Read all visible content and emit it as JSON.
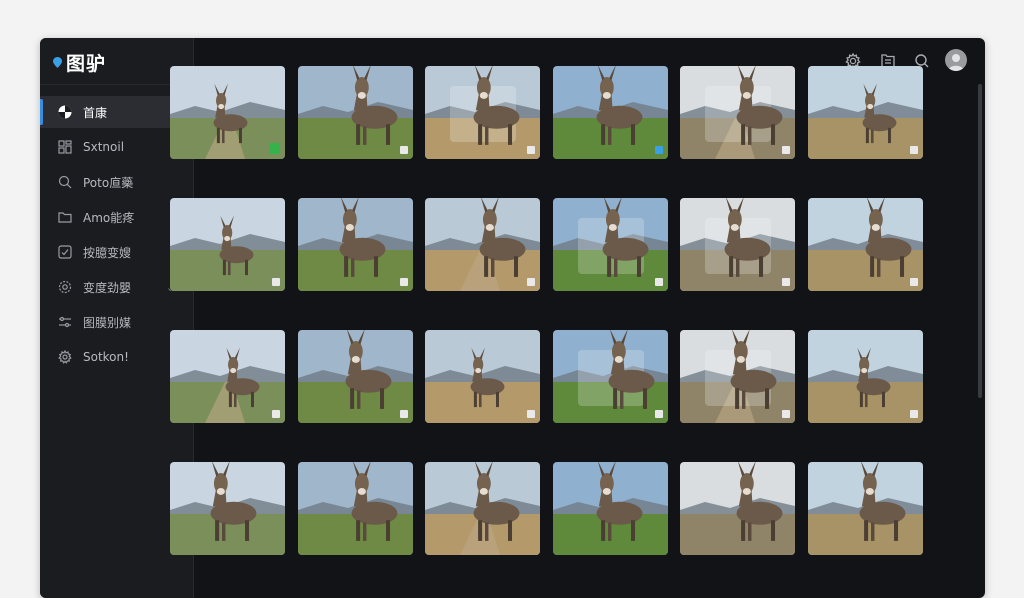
{
  "app": {
    "title": "图驴"
  },
  "sidebar": {
    "items": [
      {
        "label": "首康",
        "icon": "pinwheel-icon",
        "active": true
      },
      {
        "label": "Sxtnoil",
        "icon": "grid-icon"
      },
      {
        "label": "Poto㡺藥",
        "icon": "search-person-icon"
      },
      {
        "label": "Amo能疼",
        "icon": "folder-icon",
        "trail": "›"
      },
      {
        "label": "按臆变嫂",
        "icon": "checkbox-icon"
      },
      {
        "label": "变度劲嬰",
        "icon": "gear-icon",
        "trail": "⌄"
      },
      {
        "label": "图膜别媒",
        "icon": "sliders-icon"
      },
      {
        "label": "Sotkon!",
        "icon": "settings-icon"
      }
    ]
  },
  "topbar": {
    "icons": [
      "settings-icon",
      "folder-icon",
      "search-icon",
      "avatar"
    ]
  },
  "colors": {
    "accent": "#3a8dde",
    "sidebar": "#1b1c20",
    "background": "#121316"
  },
  "gallery": {
    "rows": 4,
    "columns": 6,
    "badges": [
      "green",
      "gray",
      "gray",
      "blue",
      "gray",
      "gray",
      "gray",
      "gray",
      "gray",
      "gray",
      "gray",
      "gray",
      "gray",
      "gray",
      "gray",
      "gray",
      "gray",
      "gray",
      "none",
      "none",
      "none",
      "none",
      "none",
      "none"
    ]
  }
}
